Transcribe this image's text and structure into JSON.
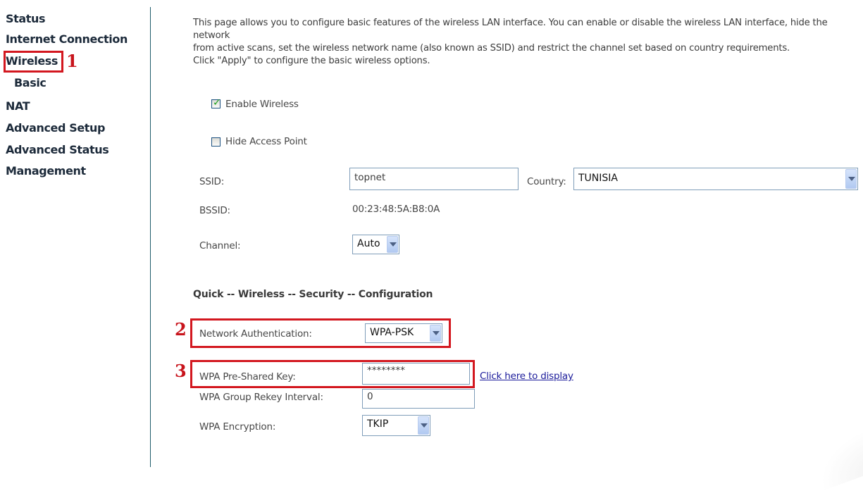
{
  "sidebar": {
    "items": [
      {
        "id": "status",
        "label": "Status"
      },
      {
        "id": "internet-connection",
        "label": "Internet Connection"
      },
      {
        "id": "wireless",
        "label": "Wireless"
      },
      {
        "id": "basic",
        "label": "Basic"
      },
      {
        "id": "nat",
        "label": "NAT"
      },
      {
        "id": "advanced-setup",
        "label": "Advanced Setup"
      },
      {
        "id": "advanced-status",
        "label": "Advanced Status"
      },
      {
        "id": "management",
        "label": "Management"
      }
    ]
  },
  "annotations": {
    "step1": "1",
    "step2": "2",
    "step3": "3",
    "highlight_color": "#d3171f"
  },
  "main": {
    "intro_line1": "This page allows you to configure basic features of the wireless LAN interface. You can enable or disable the wireless LAN interface, hide the network",
    "intro_line2": "from active scans, set the wireless network name (also known as SSID) and restrict the channel set based on country requirements.",
    "intro_line3": "Click \"Apply\" to configure the basic wireless options.",
    "enable_wireless": {
      "label": "Enable Wireless",
      "checked": true
    },
    "hide_access_point": {
      "label": "Hide Access Point",
      "checked": false
    },
    "ssid": {
      "label": "SSID:",
      "value": "topnet"
    },
    "country": {
      "label": "Country:",
      "value": "TUNISIA"
    },
    "bssid": {
      "label": "BSSID:",
      "value": "00:23:48:5A:B8:0A"
    },
    "channel": {
      "label": "Channel:",
      "value": "Auto"
    },
    "security_heading": "Quick -- Wireless -- Security -- Configuration",
    "network_auth": {
      "label": "Network Authentication:",
      "value": "WPA-PSK"
    },
    "psk": {
      "label": "WPA Pre-Shared Key:",
      "value": "********",
      "link": "Click here to display"
    },
    "rekey": {
      "label": "WPA Group Rekey Interval:",
      "value": "0"
    },
    "encryption": {
      "label": "WPA Encryption:",
      "value": "TKIP"
    }
  }
}
